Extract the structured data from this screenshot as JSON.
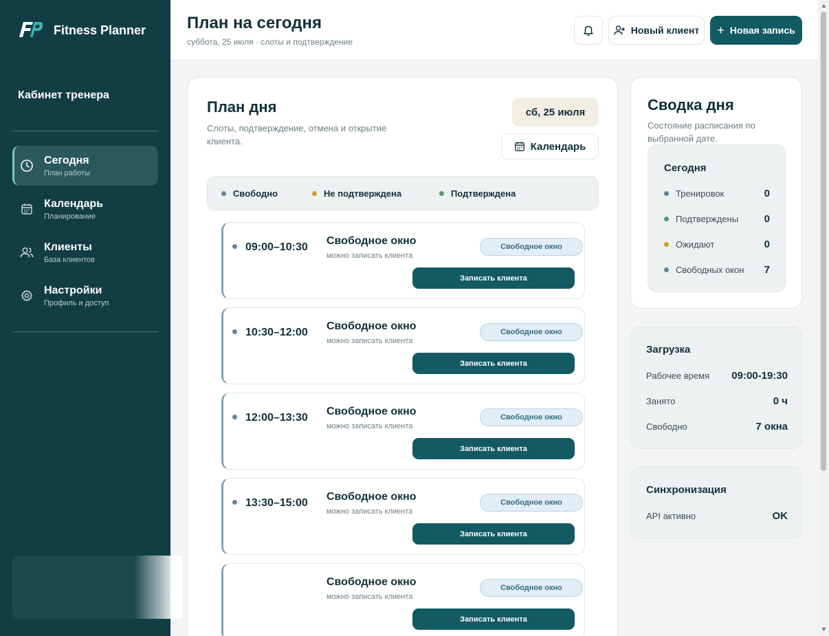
{
  "brand": {
    "logo_text": "FP",
    "name": "Fitness Planner"
  },
  "sidebar": {
    "section_title": "Кабинет тренера",
    "items": [
      {
        "title": "Сегодня",
        "subtitle": "План работы",
        "icon": "clock-icon",
        "active": true
      },
      {
        "title": "Календарь",
        "subtitle": "Планирование",
        "icon": "calendar-icon",
        "active": false
      },
      {
        "title": "Клиенты",
        "subtitle": "База клиентов",
        "icon": "users-icon",
        "active": false
      },
      {
        "title": "Настройки",
        "subtitle": "Профиль и доступ",
        "icon": "gear-icon",
        "active": false
      }
    ]
  },
  "header": {
    "title": "План на сегодня",
    "subtitle": "суббота, 25 июля · слоты и подтверждение",
    "new_client_label": "Новый клиент",
    "new_record_label": "Новая запись"
  },
  "plan": {
    "title": "План дня",
    "description": "Слоты, подтверждение, отмена и открытие клиента.",
    "date_badge": "сб, 25 июля",
    "calendar_label": "Календарь",
    "legend": [
      {
        "label": "Свободно",
        "color": "#5f8797"
      },
      {
        "label": "Не подтверждена",
        "color": "#c9a227"
      },
      {
        "label": "Подтверждена",
        "color": "#5b9a6e"
      }
    ],
    "slots": [
      {
        "time": "09:00–10:30",
        "title": "Свободное окно",
        "subtitle": "можно записать клиента",
        "badge": "Свободное окно",
        "button": "Записать клиента"
      },
      {
        "time": "10:30–12:00",
        "title": "Свободное окно",
        "subtitle": "можно записать клиента",
        "badge": "Свободное окно",
        "button": "Записать клиента"
      },
      {
        "time": "12:00–13:30",
        "title": "Свободное окно",
        "subtitle": "можно записать клиента",
        "badge": "Свободное окно",
        "button": "Записать клиента"
      },
      {
        "time": "13:30–15:00",
        "title": "Свободное окно",
        "subtitle": "можно записать клиента",
        "badge": "Свободное окно",
        "button": "Записать клиента"
      },
      {
        "time": "",
        "title": "Свободное окно",
        "subtitle": "можно записать клиента",
        "badge": "Свободное окно",
        "button": "Записать клиента"
      }
    ]
  },
  "summary": {
    "title": "Сводка дня",
    "description": "Состояние расписания по выбранной дате.",
    "today_title": "Сегодня",
    "stats": [
      {
        "label": "Тренировок",
        "value": "0",
        "color": "#5f8797"
      },
      {
        "label": "Подтверждены",
        "value": "0",
        "color": "#5b9a6e"
      },
      {
        "label": "Ожидают",
        "value": "0",
        "color": "#c9a227"
      },
      {
        "label": "Свободных окон",
        "value": "7",
        "color": "#5f8797"
      }
    ]
  },
  "load": {
    "title": "Загрузка",
    "rows": [
      {
        "label": "Рабочее время",
        "value": "09:00-19:30"
      },
      {
        "label": "Занято",
        "value": "0 ч"
      },
      {
        "label": "Свободно",
        "value": "7 окна"
      }
    ]
  },
  "sync": {
    "title": "Синхронизация",
    "rows": [
      {
        "label": "API активно",
        "value": "OK"
      }
    ]
  }
}
